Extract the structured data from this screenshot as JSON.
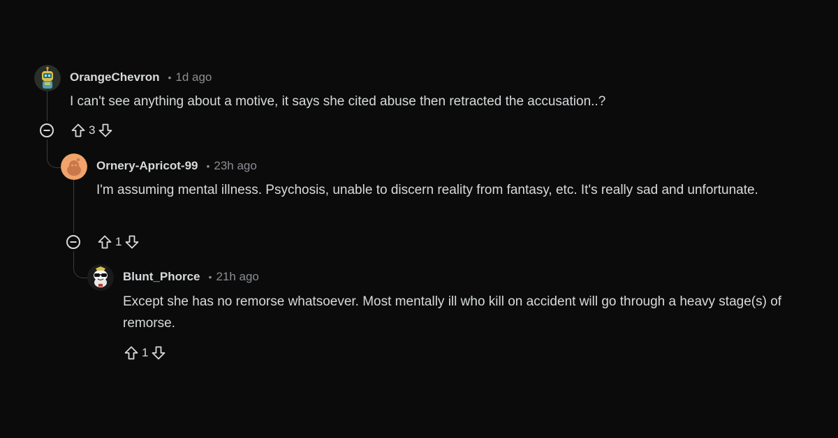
{
  "comments": [
    {
      "username": "OrangeChevron",
      "time": "1d ago",
      "body": "I can't see anything about a motive, it says she cited abuse then retracted the accusation..?",
      "votes": "3",
      "avatar": "snoo-robot-avatar"
    },
    {
      "username": "Ornery-Apricot-99",
      "time": "23h ago",
      "body": "I'm assuming mental illness. Psychosis, unable to discern reality from fantasy, etc. It's really sad and unfortunate.",
      "votes": "1",
      "avatar": "default-orange-snoo-avatar"
    },
    {
      "username": "Blunt_Phorce",
      "time": "21h ago",
      "body": "Except she has no remorse whatsoever. Most mentally ill who kill on accident will go through a heavy stage(s) of remorse.",
      "votes": "1",
      "avatar": "sunglasses-snoo-avatar"
    }
  ],
  "colors": {
    "background": "#0b0b0b",
    "text": "#d7dadc",
    "muted": "#8a8d91",
    "thread_line": "#3a3d3f",
    "avatar_orange": "#f0a36a"
  }
}
